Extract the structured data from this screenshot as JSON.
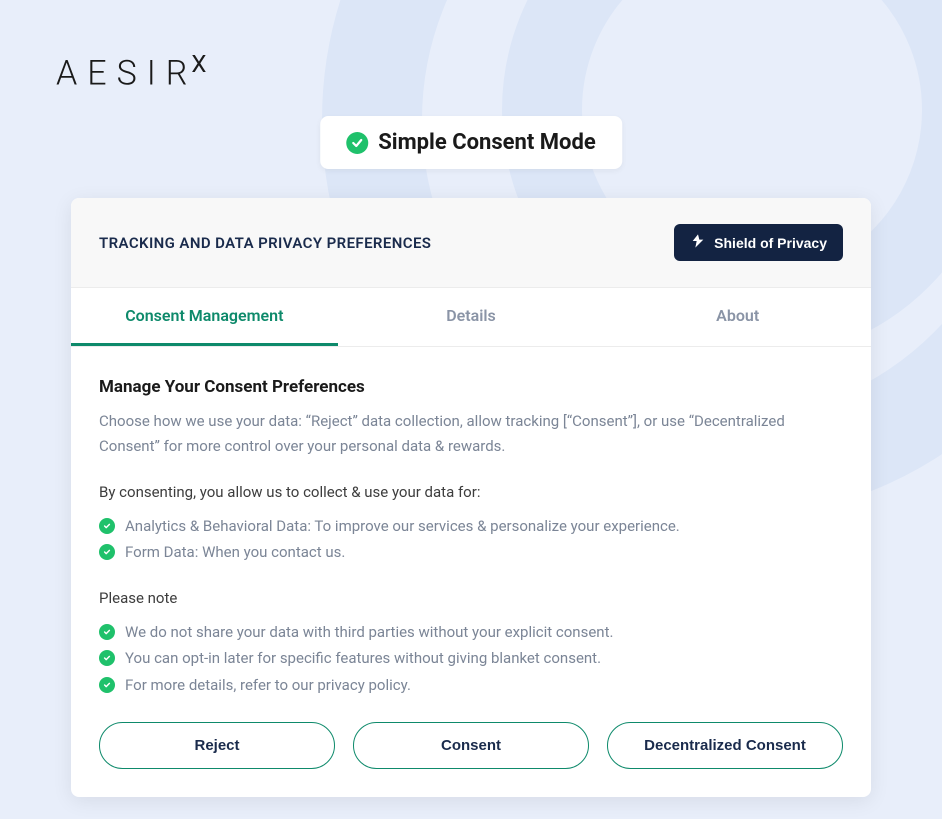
{
  "brand": {
    "name": "AESIR",
    "suffix": "X"
  },
  "modeBadge": {
    "text": "Simple Consent Mode"
  },
  "card": {
    "headerTitle": "TRACKING AND DATA PRIVACY PREFERENCES",
    "shieldButton": "Shield of Privacy"
  },
  "tabs": {
    "consent": "Consent Management",
    "details": "Details",
    "about": "About"
  },
  "content": {
    "title": "Manage Your Consent Preferences",
    "description": "Choose how we use your data: “Reject” data collection, allow tracking [“Consent”], or use “Decentralized Consent” for more control over your personal data & rewards.",
    "allowTitle": "By consenting, you allow us to collect & use your data for:",
    "allowItems": [
      "Analytics & Behavioral Data: To improve our services & personalize your experience.",
      "Form Data: When you contact us."
    ],
    "noteTitle": "Please note",
    "noteItems": [
      "We do not share your data with third parties without your explicit consent.",
      "You can opt-in later for specific features without giving blanket consent.",
      "For more details, refer to our privacy policy."
    ]
  },
  "buttons": {
    "reject": "Reject",
    "consent": "Consent",
    "decentralized": "Decentralized Consent"
  }
}
